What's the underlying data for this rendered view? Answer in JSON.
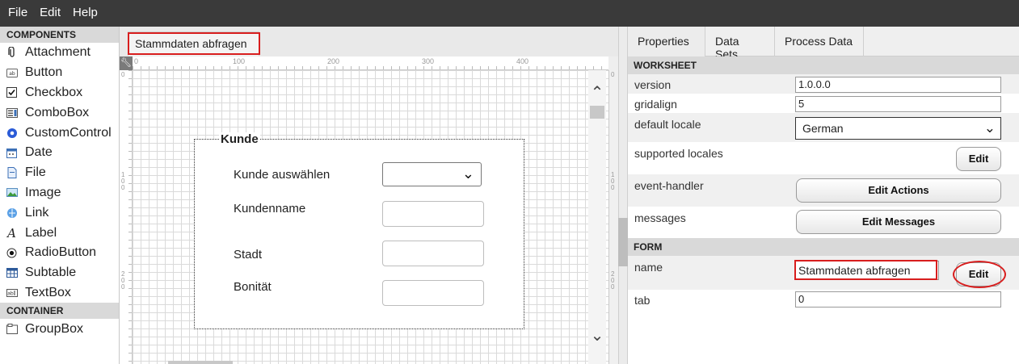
{
  "menu": {
    "file": "File",
    "edit": "Edit",
    "help": "Help"
  },
  "palette": {
    "components_header": "COMPONENTS",
    "components": [
      {
        "label": "Attachment",
        "icon": "paperclip-icon"
      },
      {
        "label": "Button",
        "icon": "button-icon"
      },
      {
        "label": "Checkbox",
        "icon": "checkbox-icon"
      },
      {
        "label": "ComboBox",
        "icon": "combobox-icon"
      },
      {
        "label": "CustomControl",
        "icon": "custom-control-icon"
      },
      {
        "label": "Date",
        "icon": "calendar-icon"
      },
      {
        "label": "File",
        "icon": "file-icon"
      },
      {
        "label": "Image",
        "icon": "image-icon"
      },
      {
        "label": "Link",
        "icon": "link-icon"
      },
      {
        "label": "Label",
        "icon": "label-icon"
      },
      {
        "label": "RadioButton",
        "icon": "radio-icon"
      },
      {
        "label": "Subtable",
        "icon": "table-icon"
      },
      {
        "label": "TextBox",
        "icon": "textbox-icon"
      }
    ],
    "container_header": "CONTAINER",
    "containers": [
      {
        "label": "GroupBox",
        "icon": "groupbox-icon"
      }
    ]
  },
  "editor": {
    "doc_tab": "Stammdaten abfragen",
    "ruler_top": [
      "0",
      "100",
      "200",
      "300",
      "400"
    ],
    "ruler_left": [
      "0",
      "100",
      "200"
    ],
    "form": {
      "group_title": "Kunde",
      "select_customer_label": "Kunde auswählen",
      "customer_name_label": "Kundenname",
      "city_label": "Stadt",
      "credit_label": "Bonität"
    }
  },
  "properties": {
    "tabs": [
      "Properties",
      "Data Sets",
      "Process Data"
    ],
    "worksheet_header": "WORKSHEET",
    "version_label": "version",
    "version_value": "1.0.0.0",
    "gridalign_label": "gridalign",
    "gridalign_value": "5",
    "default_locale_label": "default locale",
    "default_locale_value": "German",
    "supported_locales_label": "supported locales",
    "edit_label": "Edit",
    "event_handler_label": "event-handler",
    "edit_actions_label": "Edit Actions",
    "messages_label": "messages",
    "edit_messages_label": "Edit Messages",
    "form_header": "FORM",
    "name_label": "name",
    "name_value": "Stammdaten abfragen",
    "name_edit_label": "Edit",
    "tab_label": "tab",
    "tab_value": "0"
  },
  "colors": {
    "menubar": "#3a3a3a",
    "highlight": "#d81e1e",
    "section_header": "#d9d9d9"
  }
}
